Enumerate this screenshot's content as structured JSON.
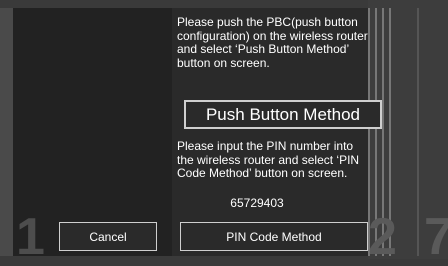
{
  "left": {
    "cancel_label": "Cancel",
    "background_number": "1"
  },
  "main": {
    "instruction_pbc": "Please push the PBC(push button configuration) on the wireless router and select ‘Push Button Method’ button on screen.",
    "push_button_label": "Push Button Method",
    "instruction_pin": "Please input the PIN number into the wireless router and select ‘PIN Code Method’ button on screen.",
    "pin_code": "65729403",
    "pin_button_label": "PIN Code Method"
  },
  "right": {
    "background_numbers": [
      "2",
      "7"
    ]
  }
}
